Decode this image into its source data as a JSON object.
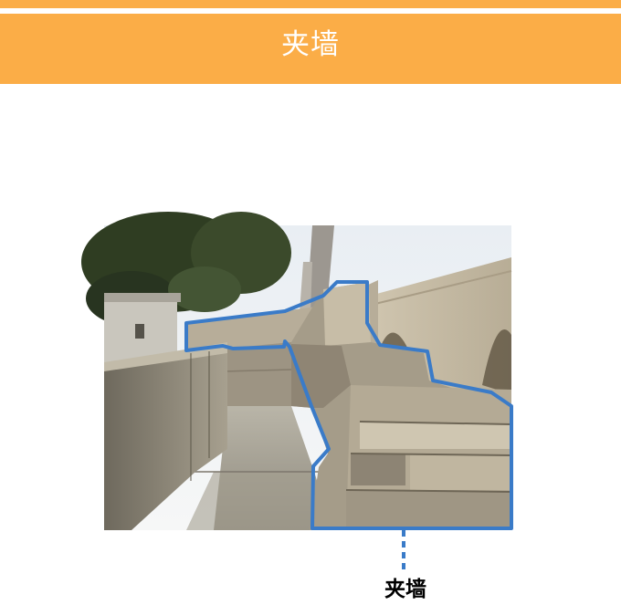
{
  "header": {
    "title": "夹墙"
  },
  "photo": {
    "subject": "stone-fortress-wall-photo"
  },
  "annotation": {
    "label": "夹墙"
  },
  "colors": {
    "banner": "#fbad47",
    "outline": "#3a7bc8",
    "title_text": "#ffffff"
  }
}
